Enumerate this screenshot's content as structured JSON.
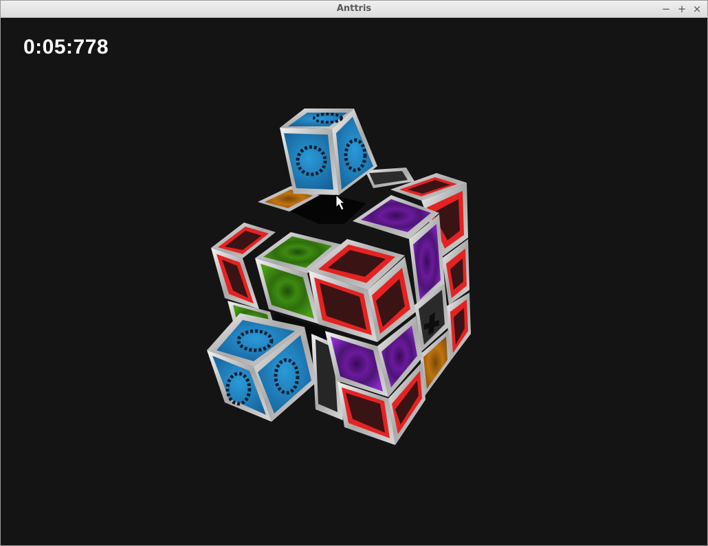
{
  "window": {
    "title": "Anttris"
  },
  "controls": {
    "minimize": "−",
    "maximize": "+",
    "close": "×"
  },
  "hud": {
    "timer": "0:05:778"
  },
  "colors": {
    "background": "#141414",
    "red_tile": "#e52222",
    "green_tile": "#3e9a12",
    "purple_tile": "#7a22b0",
    "blue_piece": "#1f86c6",
    "orange_tile": "#c87a10",
    "gray_tile": "#2e2e2e"
  },
  "icons": {
    "cursor": "mouse-pointer-icon"
  }
}
